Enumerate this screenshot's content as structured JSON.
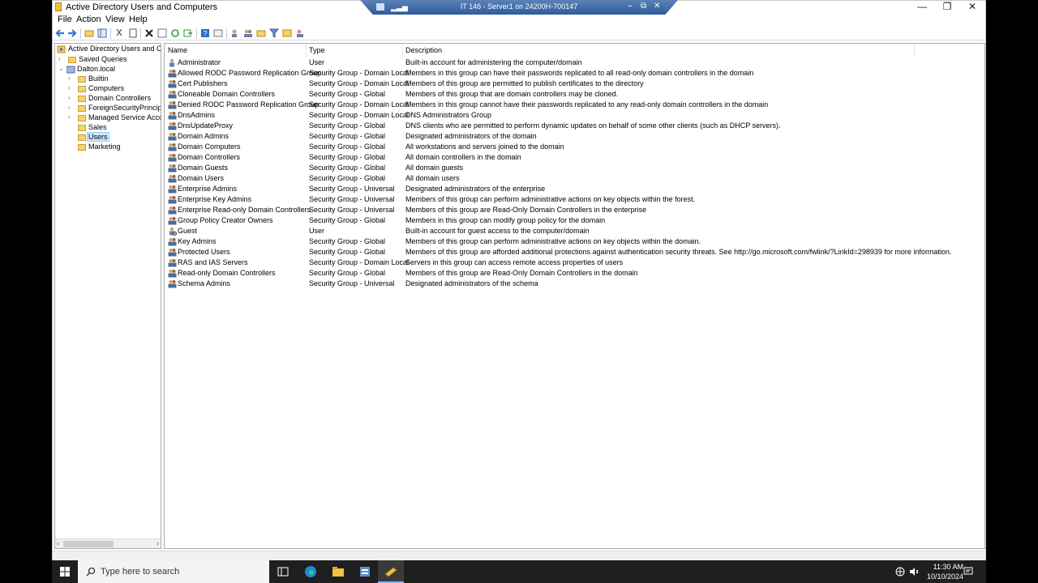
{
  "titlebar": {
    "title": "Active Directory Users and Computers",
    "minimize": "—",
    "maximize": "❐",
    "close": "✕"
  },
  "rdp": {
    "title": "IT 146 - Server1 on 24200H-700147",
    "minimize": "–",
    "restore": "⧉",
    "close": "✕"
  },
  "menubar": [
    "File",
    "Action",
    "View",
    "Help"
  ],
  "tree": {
    "root": "Active Directory Users and Com",
    "items": [
      {
        "label": "Saved Queries"
      },
      {
        "label": "Dalton.local"
      },
      {
        "label": "Builtin"
      },
      {
        "label": "Computers"
      },
      {
        "label": "Domain Controllers"
      },
      {
        "label": "ForeignSecurityPrincipals"
      },
      {
        "label": "Managed Service Accoun"
      },
      {
        "label": "Sales"
      },
      {
        "label": "Users"
      },
      {
        "label": "Marketing"
      }
    ]
  },
  "list": {
    "headers": {
      "name": "Name",
      "type": "Type",
      "description": "Description"
    },
    "rows": [
      {
        "name": "Administrator",
        "type": "User",
        "description": "Built-in account for administering the computer/domain",
        "icon": "user-icon"
      },
      {
        "name": "Allowed RODC Password Replication Group",
        "type": "Security Group - Domain Local",
        "description": "Members in this group can have their passwords replicated to all read-only domain controllers in the domain",
        "icon": "group-icon"
      },
      {
        "name": "Cert Publishers",
        "type": "Security Group - Domain Local",
        "description": "Members of this group are permitted to publish certificates to the directory",
        "icon": "group-icon"
      },
      {
        "name": "Cloneable Domain Controllers",
        "type": "Security Group - Global",
        "description": "Members of this group that are domain controllers may be cloned.",
        "icon": "group-icon"
      },
      {
        "name": "Denied RODC Password Replication Group",
        "type": "Security Group - Domain Local",
        "description": "Members in this group cannot have their passwords replicated to any read-only domain controllers in the domain",
        "icon": "group-icon"
      },
      {
        "name": "DnsAdmins",
        "type": "Security Group - Domain Local",
        "description": "DNS Administrators Group",
        "icon": "group-icon"
      },
      {
        "name": "DnsUpdateProxy",
        "type": "Security Group - Global",
        "description": "DNS clients who are permitted to perform dynamic updates on behalf of some other clients (such as DHCP servers).",
        "icon": "group-icon"
      },
      {
        "name": "Domain Admins",
        "type": "Security Group - Global",
        "description": "Designated administrators of the domain",
        "icon": "group-icon"
      },
      {
        "name": "Domain Computers",
        "type": "Security Group - Global",
        "description": "All workstations and servers joined to the domain",
        "icon": "group-icon"
      },
      {
        "name": "Domain Controllers",
        "type": "Security Group - Global",
        "description": "All domain controllers in the domain",
        "icon": "group-icon"
      },
      {
        "name": "Domain Guests",
        "type": "Security Group - Global",
        "description": "All domain guests",
        "icon": "group-icon"
      },
      {
        "name": "Domain Users",
        "type": "Security Group - Global",
        "description": "All domain users",
        "icon": "group-icon"
      },
      {
        "name": "Enterprise Admins",
        "type": "Security Group - Universal",
        "description": "Designated administrators of the enterprise",
        "icon": "group-icon"
      },
      {
        "name": "Enterprise Key Admins",
        "type": "Security Group - Universal",
        "description": "Members of this group can perform administrative actions on key objects within the forest.",
        "icon": "group-icon"
      },
      {
        "name": "Enterprise Read-only Domain Controllers",
        "type": "Security Group - Universal",
        "description": "Members of this group are Read-Only Domain Controllers in the enterprise",
        "icon": "group-icon"
      },
      {
        "name": "Group Policy Creator Owners",
        "type": "Security Group - Global",
        "description": "Members in this group can modify group policy for the domain",
        "icon": "group-icon"
      },
      {
        "name": "Guest",
        "type": "User",
        "description": "Built-in account for guest access to the computer/domain",
        "icon": "user-disabled-icon"
      },
      {
        "name": "Key Admins",
        "type": "Security Group - Global",
        "description": "Members of this group can perform administrative actions on key objects within the domain.",
        "icon": "group-icon"
      },
      {
        "name": "Protected Users",
        "type": "Security Group - Global",
        "description": "Members of this group are afforded additional protections against authentication security threats. See http://go.microsoft.com/fwlink/?LinkId=298939 for more information.",
        "icon": "group-icon"
      },
      {
        "name": "RAS and IAS Servers",
        "type": "Security Group - Domain Local",
        "description": "Servers in this group can access remote access properties of users",
        "icon": "group-icon"
      },
      {
        "name": "Read-only Domain Controllers",
        "type": "Security Group - Global",
        "description": "Members of this group are Read-Only Domain Controllers in the domain",
        "icon": "group-icon"
      },
      {
        "name": "Schema Admins",
        "type": "Security Group - Universal",
        "description": "Designated administrators of the schema",
        "icon": "group-icon"
      }
    ]
  },
  "taskbar": {
    "search_placeholder": "Type here to search",
    "time": "11:30 AM",
    "date": "10/10/2024"
  },
  "colors": {
    "selection": "#cce8ff",
    "taskbar": "#1f1f1f",
    "rdp_bar": "#2f5c9a"
  }
}
